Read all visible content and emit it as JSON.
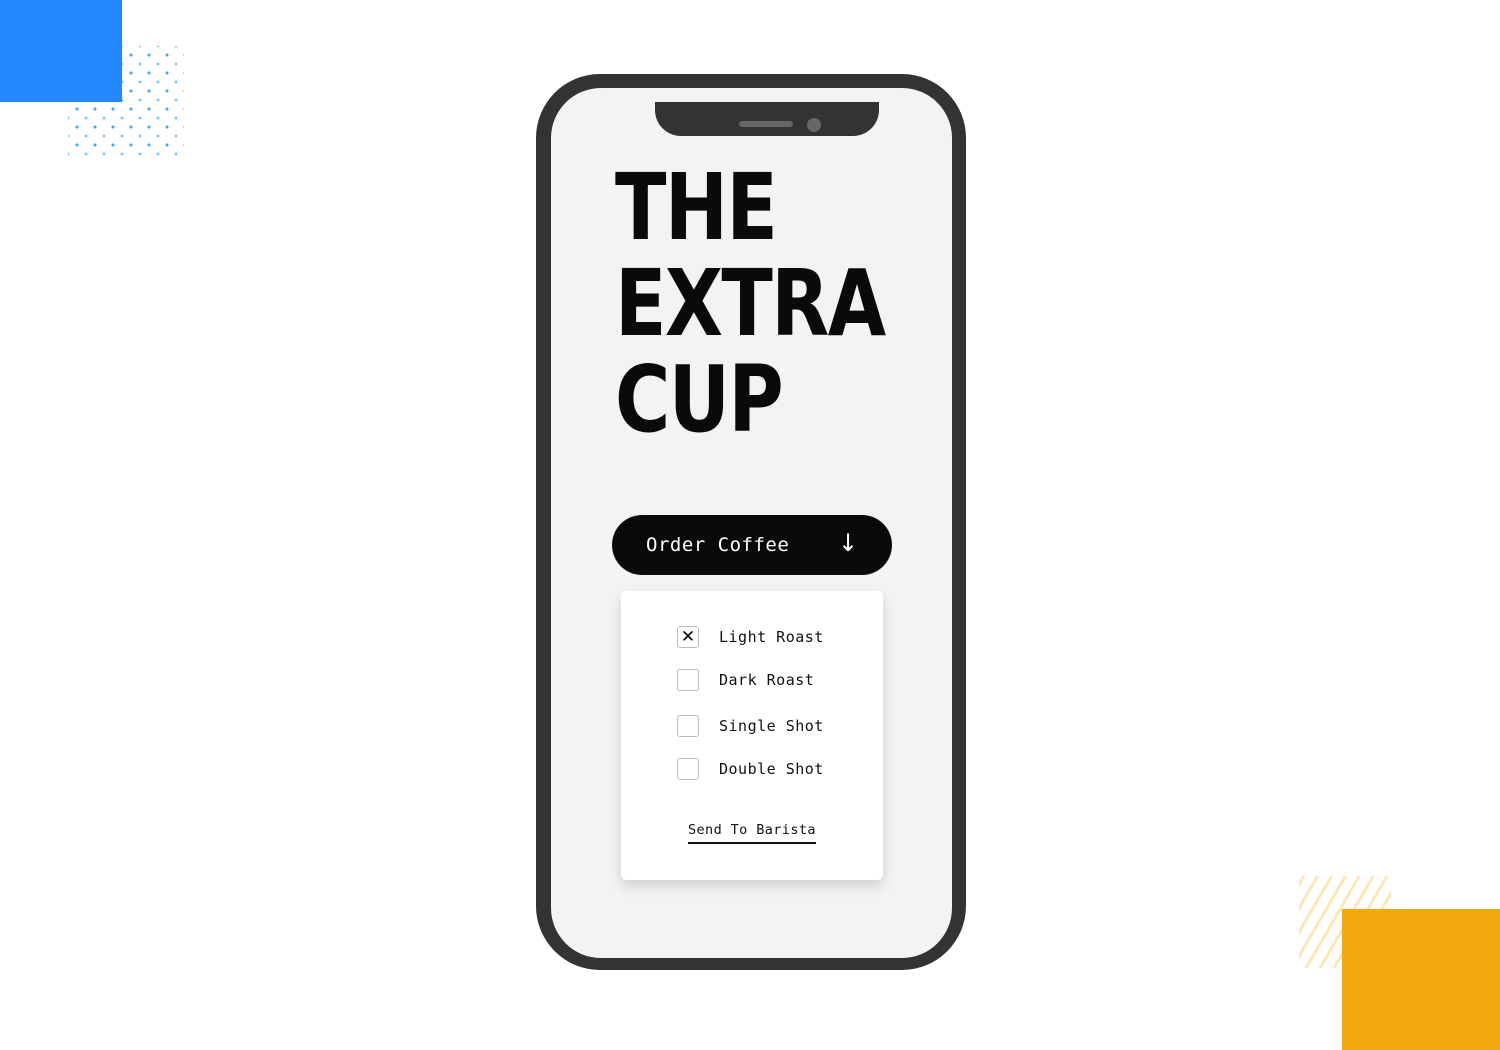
{
  "decorations": {
    "top_left_color": "#2388ff",
    "bottom_right_color": "#f1a80e"
  },
  "app": {
    "title_lines": [
      "THE",
      "EXTRA",
      "CUP"
    ],
    "order_button": {
      "label": "Order Coffee",
      "icon": "arrow-down-icon",
      "icon_glyph": "↓"
    },
    "options": [
      {
        "label": "Light Roast",
        "checked": true,
        "mark": "✕"
      },
      {
        "label": "Dark Roast",
        "checked": false,
        "mark": ""
      },
      {
        "label": "Single Shot",
        "checked": false,
        "mark": ""
      },
      {
        "label": "Double Shot",
        "checked": false,
        "mark": ""
      }
    ],
    "send_link": "Send To Barista"
  }
}
